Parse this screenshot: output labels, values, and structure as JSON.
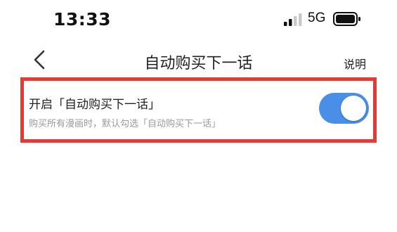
{
  "status_bar": {
    "time": "13:33",
    "network": "5G"
  },
  "nav": {
    "title": "自动购买下一话",
    "action_label": "说明"
  },
  "setting": {
    "title": "开启「自动购买下一话」",
    "description": "购买所有漫画时，默认勾选「自动购买下一话」",
    "enabled": true
  },
  "colors": {
    "toggle_on": "#4a8fe7",
    "highlight_border": "#e53935"
  }
}
